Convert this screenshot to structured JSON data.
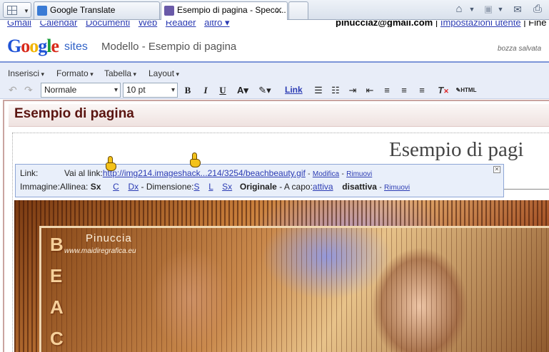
{
  "browser": {
    "tabs": [
      {
        "label": "Google Translate",
        "favicon_color": "#3a7bd5"
      },
      {
        "label": "Esempio di pagina - Specc...",
        "favicon_color": "#6a5aa8"
      }
    ],
    "icons": [
      "home-icon",
      "rss-icon",
      "mail-icon",
      "print-icon"
    ]
  },
  "gbar": {
    "links": [
      "Gmail",
      "Calendar",
      "Documenti",
      "Web",
      "Reader",
      "altro ▾"
    ],
    "email": "pinucciaz@gmail.com",
    "separator": "|",
    "settings_link": "Impostazioni utente",
    "truncated": "| Fine"
  },
  "header": {
    "logo": [
      "G",
      "o",
      "o",
      "g",
      "l",
      "e"
    ],
    "sites_label": "sites",
    "breadcrumb": "Modello -  Esempio di pagina",
    "saved_status": "bozza salvata"
  },
  "menubar": {
    "items": [
      "Inserisci",
      "Formato",
      "Tabella",
      "Layout"
    ]
  },
  "toolbar": {
    "style_value": "Normale",
    "size_value": "10 pt",
    "bold": "B",
    "italic": "I",
    "underline": "U",
    "link_label": "Link",
    "html_label": "HTML"
  },
  "page": {
    "title": "Esempio di pagina",
    "heading": "Esempio di pagi"
  },
  "popup": {
    "link_label": "Link:",
    "goto_label": "Vai al link:",
    "url": "http://img214.imageshack...214/3254/beachbeauty.gif",
    "dash1": "-",
    "modify": "Modifica",
    "dash2": "-",
    "remove": "Rimuovi",
    "image_label": "Immagine:",
    "align_label": "Allinea:",
    "align_sx": "Sx",
    "align_c": "C",
    "align_dx": "Dx",
    "size_label": "- Dimensione:",
    "size_s": "S",
    "size_l": "L",
    "size_sx": "Sx",
    "size_original": "Originale",
    "wrap_label": "- A capo:",
    "wrap_on": "attiva",
    "wrap_off": "disattiva",
    "dash3": "-",
    "remove2": "Rimuovi"
  },
  "image": {
    "watermark_name": "Pinuccia",
    "watermark_site": "www.maidiregrafica.eu",
    "letters": [
      "B",
      "E",
      "A",
      "C"
    ]
  }
}
